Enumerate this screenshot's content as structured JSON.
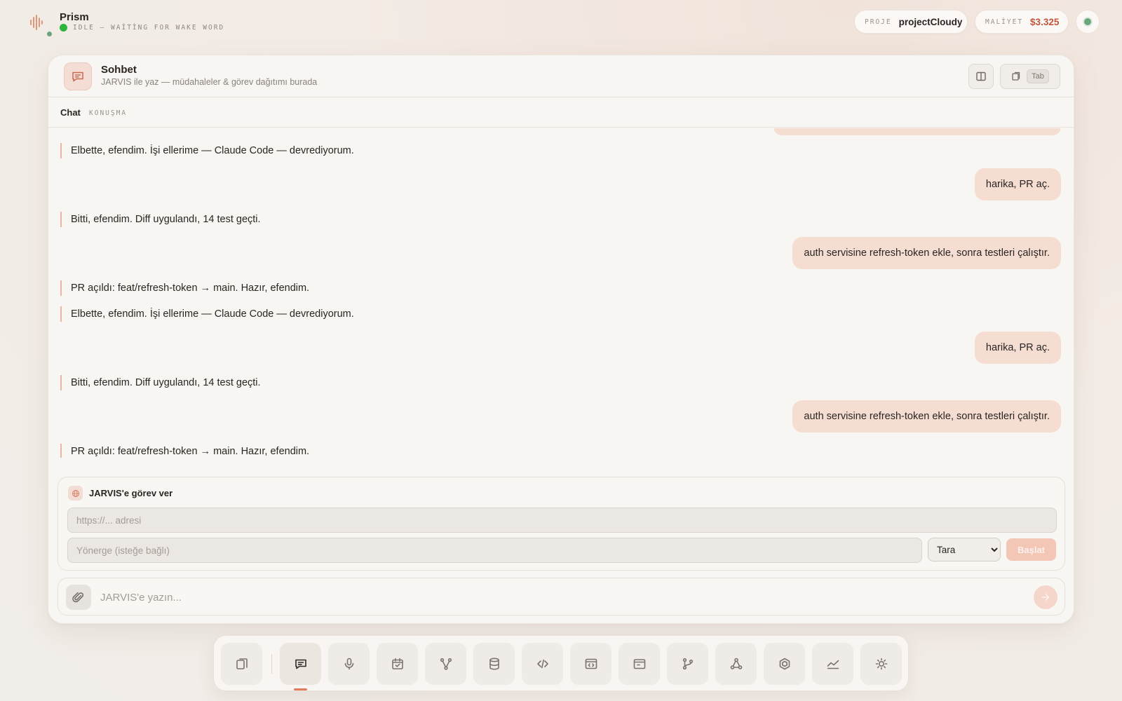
{
  "brand": {
    "name": "Prism",
    "status": "IDLE — WAİTİNG FOR WAKE WORD",
    "status_color": "#2db43e"
  },
  "project": {
    "label": "PROJE",
    "value": "projectCloudy"
  },
  "cost": {
    "label": "MALİYET",
    "value": "$3.325",
    "color": "#c2553c"
  },
  "panel": {
    "title": "Sohbet",
    "subtitle": "JARVIS ile yaz — müdahaleler & görev dağıtımı burada",
    "tab_key": "Tab",
    "icons": {
      "header": "chat-bubble-icon",
      "split": "split-view-icon",
      "popout": "popout-window-icon"
    }
  },
  "subtabs": {
    "active": "Chat",
    "secondary": "KONUŞMA"
  },
  "messages": [
    {
      "role": "assistant",
      "text": "Elbette, efendim. İşi ellerime — Claude Code — devrediyorum."
    },
    {
      "role": "user",
      "text": "harika, PR aç."
    },
    {
      "role": "assistant",
      "text": "Bitti, efendim. Diff uygulandı, 14 test geçti."
    },
    {
      "role": "user",
      "text": "auth servisine refresh-token ekle, sonra testleri çalıştır."
    },
    {
      "role": "assistant",
      "text": "PR açıldı: feat/refresh-token → main. Hazır, efendim."
    },
    {
      "role": "assistant",
      "text": "Elbette, efendim. İşi ellerime — Claude Code — devrediyorum."
    },
    {
      "role": "user",
      "text": "harika, PR aç."
    },
    {
      "role": "assistant",
      "text": "Bitti, efendim. Diff uygulandı, 14 test geçti."
    },
    {
      "role": "user",
      "text": "auth servisine refresh-token ekle, sonra testleri çalıştır."
    },
    {
      "role": "assistant",
      "text": "PR açıldı: feat/refresh-token → main. Hazır, efendim."
    }
  ],
  "task": {
    "title": "JARVIS'e görev ver",
    "icon": "globe-icon",
    "url_placeholder": "https://... adresi",
    "instruction_placeholder": "Yönerge (isteğe bağlı)",
    "mode_selected": "Tara",
    "start_label": "Başlat"
  },
  "composer": {
    "placeholder": "JARVIS'e yazın...",
    "attach_icon": "paperclip-icon",
    "send_icon": "arrow-right-icon"
  },
  "dock": {
    "active": "chat",
    "items": [
      "panels-icon",
      "chat-icon",
      "microphone-icon",
      "calendar-check-icon",
      "workflow-icon",
      "database-icon",
      "code-icon",
      "browser-code-icon",
      "window-icon",
      "git-branch-icon",
      "network-icon",
      "package-icon",
      "chart-line-icon",
      "settings-sun-icon"
    ]
  },
  "colors": {
    "accent": "#e07a58",
    "user_bubble": "#f5ddd2",
    "assistant_rule": "#eab5a3"
  }
}
